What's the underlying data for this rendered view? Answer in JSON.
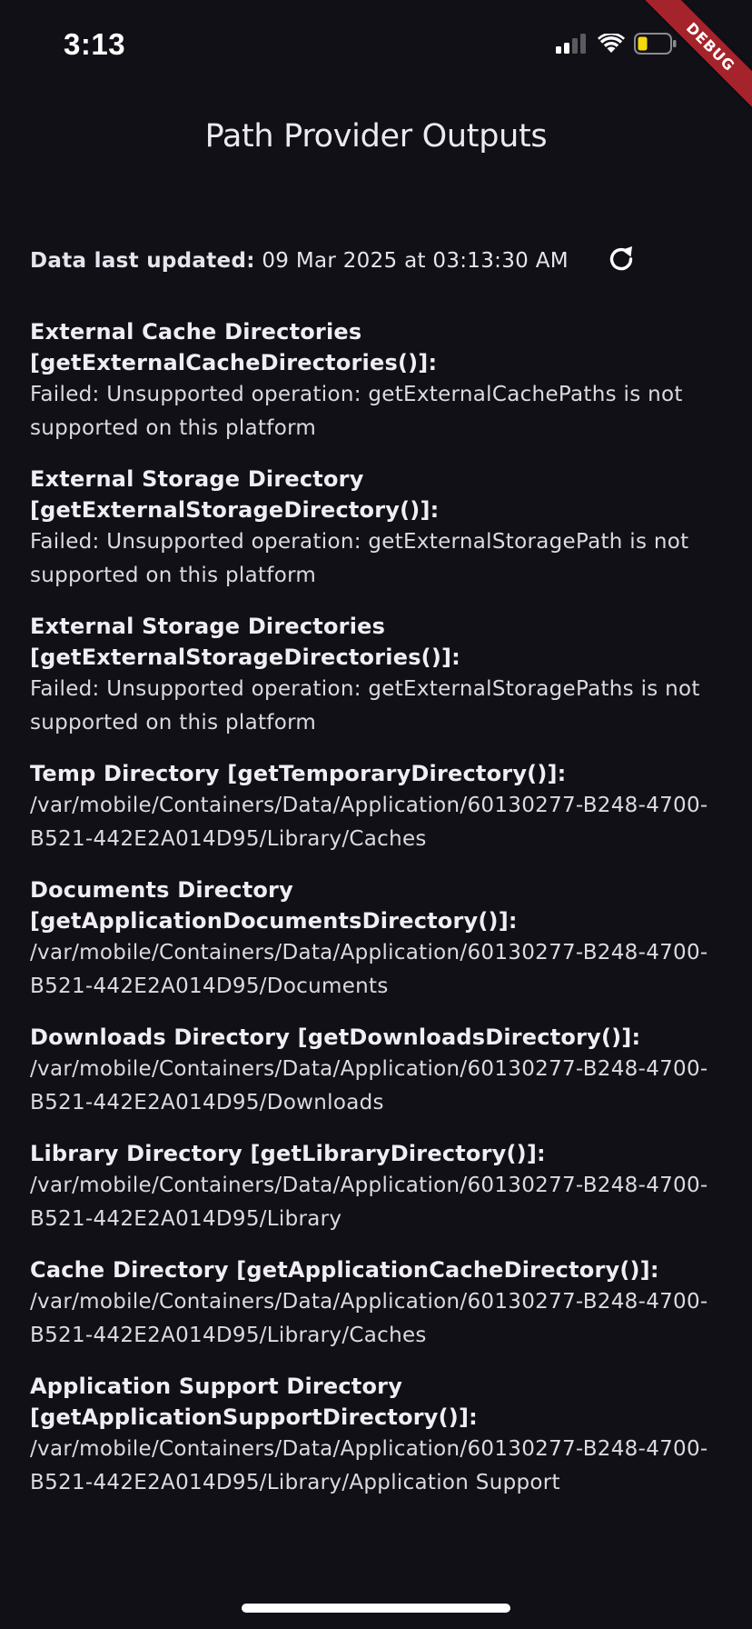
{
  "status_bar": {
    "time": "3:13",
    "icons": [
      "signal-icon",
      "wifi-icon",
      "battery-icon"
    ]
  },
  "debug_banner": {
    "label": "DEBUG",
    "color": "#a5232a"
  },
  "app_bar": {
    "title": "Path Provider Outputs"
  },
  "updated": {
    "label": "Data last updated:",
    "value": "09 Mar 2025 at 03:13:30 AM",
    "refresh_icon": "refresh-icon"
  },
  "sections": [
    {
      "heading": "External Cache Directories [getExternalCacheDirectories()]:",
      "value": "Failed: Unsupported operation: getExternalCachePaths is not supported on this platform"
    },
    {
      "heading": "External Storage Directory [getExternalStorageDirectory()]:",
      "value": "Failed: Unsupported operation: getExternalStoragePath is not supported on this platform"
    },
    {
      "heading": "External Storage Directories [getExternalStorageDirectories()]:",
      "value": "Failed: Unsupported operation: getExternalStoragePaths is not supported on this platform"
    },
    {
      "heading": "Temp Directory [getTemporaryDirectory()]:",
      "value": "/var/mobile/Containers/Data/Application/60130277-B248-4700-B521-442E2A014D95/Library/Caches"
    },
    {
      "heading": "Documents Directory [getApplicationDocumentsDirectory()]:",
      "value": "/var/mobile/Containers/Data/Application/60130277-B248-4700-B521-442E2A014D95/Documents"
    },
    {
      "heading": "Downloads Directory [getDownloadsDirectory()]:",
      "value": "/var/mobile/Containers/Data/Application/60130277-B248-4700-B521-442E2A014D95/Downloads"
    },
    {
      "heading": "Library Directory [getLibraryDirectory()]:",
      "value": "/var/mobile/Containers/Data/Application/60130277-B248-4700-B521-442E2A014D95/Library"
    },
    {
      "heading": "Cache Directory [getApplicationCacheDirectory()]:",
      "value": "/var/mobile/Containers/Data/Application/60130277-B248-4700-B521-442E2A014D95/Library/Caches"
    },
    {
      "heading": "Application Support Directory [getApplicationSupportDirectory()]:",
      "value": "/var/mobile/Containers/Data/Application/60130277-B248-4700-B521-442E2A014D95/Library/Application Support"
    }
  ],
  "colors": {
    "background": "#121017",
    "text": "#e6e4ec",
    "battery_fill": "#f5d90a"
  }
}
